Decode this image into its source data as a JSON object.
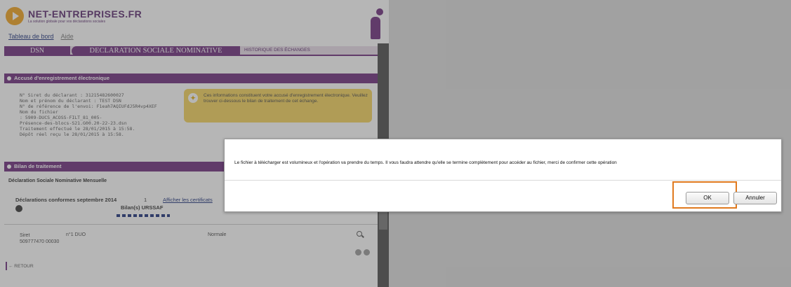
{
  "header": {
    "brand": "NET-ENTREPRISES.FR",
    "tagline": "La solution globale pour vos déclarations sociales",
    "links": [
      "Tableau de bord",
      "Aide"
    ]
  },
  "tabs": {
    "dsn": "DSN",
    "declaration": "DECLARATION SOCIALE NOMINATIVE",
    "historique": "HISTORIQUE DES ÉCHANGES"
  },
  "accuse": {
    "title": "Accusé d'enregistrement électronique",
    "lines": [
      "N° Siret du déclarant : 31215482600027",
      "Nom et prénom du déclarant : TEST DSN",
      "N° de référence de l'envoi: F1eah7AQIUFdJ5R4vp4XEF",
      "",
      "Nom du fichier",
      ":           5909-DUCS_ACOSS-FILT_81_005-",
      "Présence-des-blocs-S21.G00.20-22-23.dsn",
      "Traitement effectué le 28/01/2015 à 15:58.",
      "Dépôt réel reçu le 28/01/2015 à 15:58."
    ],
    "notice": "Ces informations constituent votre accusé d'enregistrement électronique. Veuillez trouver ci-dessous le bilan de traitement de cet échange."
  },
  "bilan": {
    "title": "Bilan de traitement",
    "dsm": "Déclaration Sociale Nominative Mensuelle",
    "declarations": "Déclarations conformes septembre 2014",
    "count": "1",
    "cert_link": "Afficher les certificats",
    "bilans": "Bilan(s) URSSAF",
    "siret_label": "Siret",
    "siret_value": "509777470 00030",
    "num": "n°1  DUO",
    "type": "Normale",
    "retour": "← RETOUR"
  },
  "dialog": {
    "message": "Le fichier à télécharger est volumineux et l'opération va prendre du temps. Il vous faudra attendre qu'elle se termine complètement pour accéder au fichier, merci de confirmer cette opération",
    "ok_label": "OK",
    "cancel_label": "Annuler",
    "highlight_color": "#e07a1f"
  },
  "colors": {
    "brand_purple": "#6d2c7d",
    "notice_yellow": "#f5d35a"
  }
}
